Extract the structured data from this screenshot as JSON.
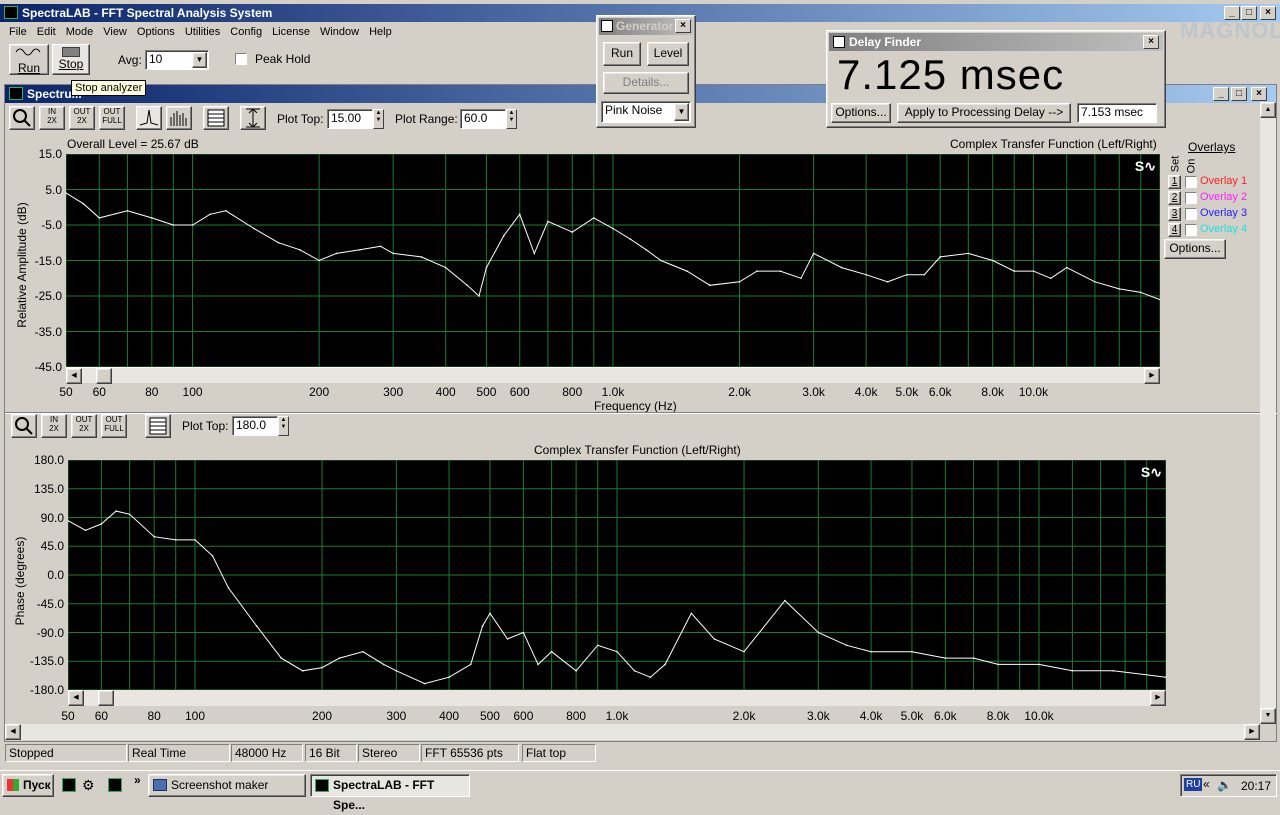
{
  "app": {
    "title": "SpectraLAB - FFT Spectral Analysis System",
    "menu": [
      "File",
      "Edit",
      "Mode",
      "View",
      "Options",
      "Utilities",
      "Config",
      "License",
      "Window",
      "Help"
    ],
    "run_label": "Run",
    "stop_label": "Stop",
    "avg_label": "Avg:",
    "avg_value": "10",
    "peak_hold_label": "Peak Hold",
    "tooltip": "Stop analyzer",
    "watermark": "MAGNOLA"
  },
  "generator": {
    "title": "Generator",
    "run_label": "Run",
    "level_label": "Level",
    "details_label": "Details...",
    "signal": "Pink Noise"
  },
  "delay_finder": {
    "title": "Delay Finder",
    "readout": "7.125 msec",
    "options_label": "Options...",
    "apply_label": "Apply to Processing Delay -->",
    "value": "7.153 msec"
  },
  "spectrum": {
    "window_title": "Spectru...",
    "plot_top_label": "Plot Top:",
    "plot_top_value": "15.00",
    "plot_range_label": "Plot Range:",
    "plot_range_value": "60.0",
    "overall_level": "Overall Level = 25.67 dB",
    "plot_title": "Complex Transfer Function (Left/Right)",
    "ylabel": "Relative Amplitude (dB)",
    "xlabel": "Frequency (Hz)",
    "overlays_title": "Overlays",
    "set_label": "Set",
    "on_label": "On",
    "overlays": [
      {
        "num": "1",
        "label": "Overlay 1",
        "color": "#ff2020"
      },
      {
        "num": "2",
        "label": "Overlay 2",
        "color": "#ff20ff"
      },
      {
        "num": "3",
        "label": "Overlay 3",
        "color": "#2020ff"
      },
      {
        "num": "4",
        "label": "Overlay 4",
        "color": "#20e0e0"
      }
    ],
    "overlay_options": "Options..."
  },
  "phase": {
    "plot_top_label": "Plot Top:",
    "plot_top_value": "180.0",
    "plot_title": "Complex Transfer Function (Left/Right)",
    "ylabel": "Phase (degrees)"
  },
  "status": [
    "Stopped",
    "Real Time",
    "48000 Hz",
    "16 Bit",
    "Stereo",
    "FFT 65536 pts",
    "Flat top"
  ],
  "taskbar": {
    "start_label": "Пуск",
    "task1": "Screenshot maker",
    "task2": "SpectraLAB - FFT Spe...",
    "lang": "RU",
    "time": "20:17"
  },
  "chart_data": [
    {
      "type": "line",
      "title": "Complex Transfer Function (Left/Right)",
      "xlabel": "Frequency (Hz)",
      "ylabel": "Relative Amplitude (dB)",
      "xscale": "log",
      "xlim": [
        50,
        20000
      ],
      "ylim": [
        -45,
        15
      ],
      "grid": true,
      "x_ticks": [
        "50",
        "60",
        "80",
        "100",
        "200",
        "300",
        "400",
        "500",
        "600",
        "800",
        "1.0k",
        "2.0k",
        "3.0k",
        "4.0k",
        "5.0k",
        "6.0k",
        "8.0k",
        "10.0k"
      ],
      "y_ticks": [
        "15.0",
        "5.0",
        "-5.0",
        "-15.0",
        "-25.0",
        "-35.0",
        "-45.0"
      ],
      "x": [
        50,
        55,
        60,
        70,
        80,
        90,
        100,
        110,
        120,
        140,
        160,
        180,
        200,
        220,
        250,
        280,
        300,
        350,
        400,
        450,
        480,
        500,
        550,
        600,
        650,
        700,
        800,
        900,
        1000,
        1100,
        1200,
        1300,
        1500,
        1700,
        2000,
        2200,
        2500,
        2800,
        3000,
        3500,
        4000,
        4500,
        5000,
        5500,
        6000,
        7000,
        8000,
        9000,
        10000,
        11000,
        12000,
        14000,
        16000,
        18000,
        20000
      ],
      "y": [
        4,
        1,
        -3,
        -1,
        -3,
        -5,
        -5,
        -2,
        -1,
        -6,
        -10,
        -12,
        -15,
        -13,
        -12,
        -11,
        -13,
        -14,
        -17,
        -22,
        -25,
        -17,
        -8,
        -2,
        -13,
        -4,
        -7,
        -3,
        -6,
        -9,
        -12,
        -15,
        -18,
        -22,
        -21,
        -18,
        -18,
        -20,
        -13,
        -17,
        -19,
        -21,
        -19,
        -19,
        -14,
        -13,
        -15,
        -18,
        -18,
        -20,
        -17,
        -21,
        -23,
        -24,
        -26
      ]
    },
    {
      "type": "line",
      "title": "Complex Transfer Function (Left/Right)",
      "xlabel": "",
      "ylabel": "Phase (degrees)",
      "xscale": "log",
      "xlim": [
        50,
        20000
      ],
      "ylim": [
        -180,
        180
      ],
      "grid": true,
      "x_ticks": [
        "50",
        "60",
        "80",
        "100",
        "200",
        "300",
        "400",
        "500",
        "600",
        "800",
        "1.0k",
        "2.0k",
        "3.0k",
        "4.0k",
        "5.0k",
        "6.0k",
        "8.0k",
        "10.0k"
      ],
      "y_ticks": [
        "180.0",
        "135.0",
        "90.0",
        "45.0",
        "0.0",
        "-45.0",
        "-90.0",
        "-135.0",
        "-180.0"
      ],
      "x": [
        50,
        55,
        60,
        65,
        70,
        80,
        90,
        100,
        110,
        120,
        140,
        160,
        180,
        200,
        220,
        250,
        280,
        300,
        350,
        400,
        450,
        480,
        500,
        550,
        600,
        650,
        700,
        800,
        900,
        1000,
        1100,
        1200,
        1300,
        1500,
        1700,
        2000,
        2500,
        3000,
        3500,
        4000,
        5000,
        6000,
        7000,
        8000,
        10000,
        12000,
        15000,
        20000
      ],
      "y": [
        85,
        70,
        80,
        100,
        95,
        60,
        55,
        55,
        30,
        -20,
        -80,
        -130,
        -150,
        -145,
        -130,
        -120,
        -140,
        -150,
        -170,
        -160,
        -140,
        -80,
        -60,
        -100,
        -90,
        -140,
        -120,
        -150,
        -110,
        -120,
        -150,
        -160,
        -140,
        -60,
        -100,
        -120,
        -40,
        -90,
        -110,
        -120,
        -120,
        -130,
        -130,
        -140,
        -140,
        -150,
        -150,
        -160
      ]
    }
  ]
}
